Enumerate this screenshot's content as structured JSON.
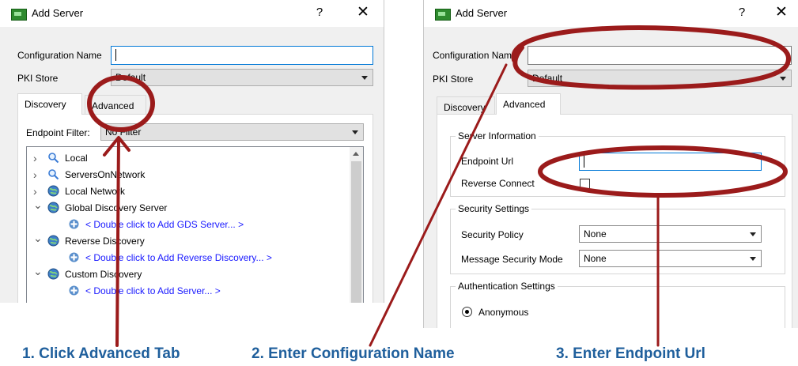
{
  "left_dialog": {
    "title": "Add Server",
    "help": "?",
    "close": "✕",
    "config_name_label": "Configuration Name",
    "config_name_value": "",
    "pki_store_label": "PKI Store",
    "pki_store_value": "Default",
    "tabs": [
      "Discovery",
      "Advanced"
    ],
    "endpoint_filter_label": "Endpoint Filter:",
    "endpoint_filter_value": "No Filter",
    "tree": [
      {
        "expander": "›",
        "icon": "search-icon",
        "label": "Local",
        "link": false
      },
      {
        "expander": "›",
        "icon": "search-icon",
        "label": "ServersOnNetwork",
        "link": false
      },
      {
        "expander": "›",
        "icon": "globe-icon",
        "label": "Local Network",
        "link": false
      },
      {
        "expander": "⌄",
        "icon": "globe-icon",
        "label": "Global Discovery Server",
        "link": false
      },
      {
        "expander": "",
        "icon": "plus-icon",
        "label": "< Double click to Add GDS Server... >",
        "link": true
      },
      {
        "expander": "⌄",
        "icon": "globe-icon",
        "label": "Reverse Discovery",
        "link": false
      },
      {
        "expander": "",
        "icon": "plus-icon",
        "label": "< Double click to Add Reverse Discovery... >",
        "link": true
      },
      {
        "expander": "⌄",
        "icon": "globe-icon",
        "label": "Custom Discovery",
        "link": false
      },
      {
        "expander": "",
        "icon": "plus-icon",
        "label": "< Double click to Add Server... >",
        "link": true
      }
    ]
  },
  "right_dialog": {
    "title": "Add Server",
    "help": "?",
    "close": "✕",
    "config_name_label": "Configuration Name",
    "config_name_value": "",
    "pki_store_label": "PKI Store",
    "pki_store_value": "Default",
    "tabs": [
      "Discovery",
      "Advanced"
    ],
    "server_info": {
      "legend": "Server Information",
      "endpoint_url_label": "Endpoint Url",
      "endpoint_url_value": "",
      "reverse_connect_label": "Reverse Connect"
    },
    "security": {
      "legend": "Security Settings",
      "policy_label": "Security Policy",
      "policy_value": "None",
      "mode_label": "Message Security Mode",
      "mode_value": "None"
    },
    "auth": {
      "legend": "Authentication Settings",
      "anonymous_label": "Anonymous"
    }
  },
  "annotations": {
    "step1": "1. Click Advanced Tab",
    "step2": "2. Enter Configuration Name",
    "step3": "3. Enter Endpoint Url",
    "color_marker": "#9b1b1b",
    "color_text": "#1f5f9c"
  }
}
